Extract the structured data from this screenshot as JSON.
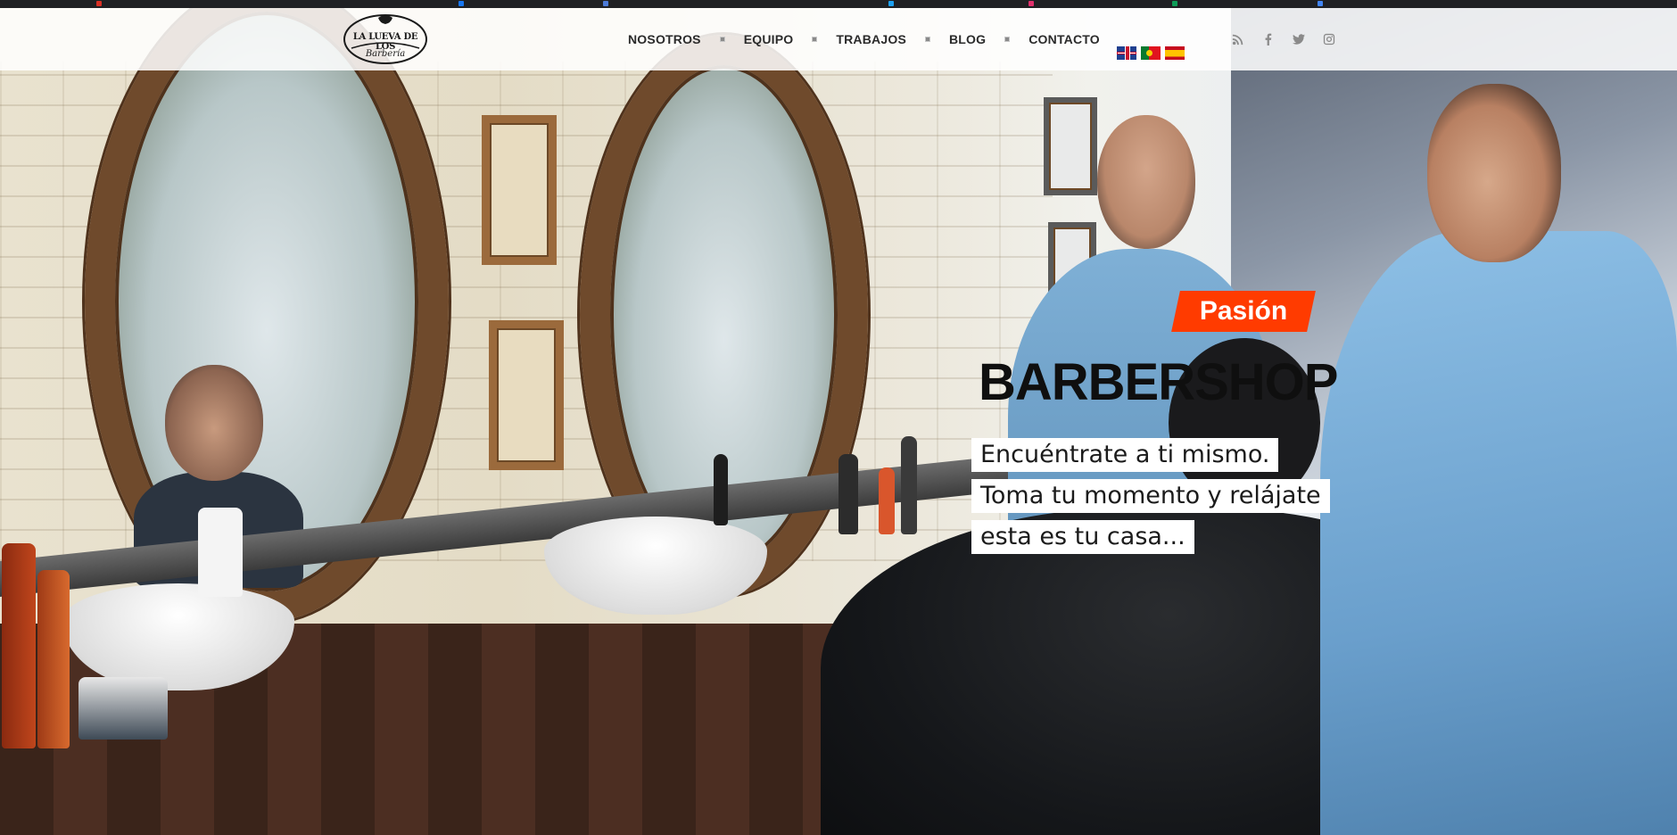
{
  "brand": {
    "logo_name": "LA LUEVA DE LOS",
    "logo_sub": "Barbería"
  },
  "nav": {
    "items": [
      {
        "label": "NOSOTROS"
      },
      {
        "label": "EQUIPO"
      },
      {
        "label": "TRABAJOS"
      },
      {
        "label": "BLOG"
      },
      {
        "label": "CONTACTO"
      }
    ]
  },
  "languages": [
    {
      "code": "en",
      "icon": "uk-flag-icon"
    },
    {
      "code": "pt",
      "icon": "portugal-flag-icon"
    },
    {
      "code": "es",
      "icon": "spain-flag-icon"
    }
  ],
  "social": [
    {
      "icon": "rss-icon"
    },
    {
      "icon": "facebook-icon"
    },
    {
      "icon": "twitter-icon"
    },
    {
      "icon": "instagram-icon"
    }
  ],
  "hero": {
    "tag": "Pasión",
    "headline": "BARBERSHOP",
    "lines": [
      "Encuéntrate a ti mismo.",
      "Toma tu momento y relájate",
      "esta es tu casa..."
    ]
  },
  "colors": {
    "accent": "#ff3b00",
    "header_bg": "#ffffff",
    "nav_text": "#2b2b2b"
  }
}
